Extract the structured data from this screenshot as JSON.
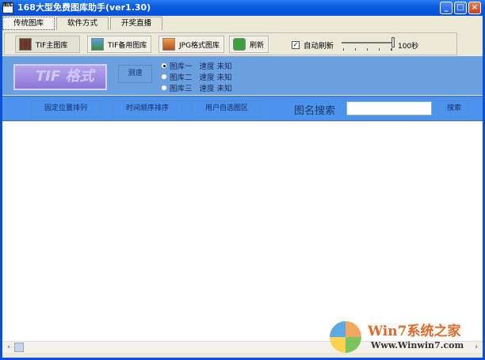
{
  "window": {
    "title": "168大型免费图库助手(ver1.30)",
    "icon_text": "图库",
    "controls": [
      "_",
      "□",
      "×"
    ]
  },
  "tabs": [
    {
      "label": "传统图库",
      "active": true
    },
    {
      "label": "软件方式"
    },
    {
      "label": "开奖直播"
    }
  ],
  "toolbar": {
    "buttons": [
      "TIF主图库",
      "TIF备用图库",
      "JPG格式图库",
      "刷新"
    ],
    "auto_refresh_label": "自动刷新",
    "auto_refresh_checked": true,
    "slider_value_label": "100秒",
    "slider_fraction": 1.0
  },
  "panel": {
    "logo_text": "TIF 格式",
    "speed_test_label": "测速",
    "libraries": [
      {
        "label": "图库一",
        "speed": "速度 未知",
        "selected": true
      },
      {
        "label": "图库二",
        "speed": "速度 未知",
        "selected": false
      },
      {
        "label": "图库三",
        "speed": "速度 未知",
        "selected": false
      }
    ]
  },
  "sortbar": {
    "buttons": [
      "固定位置排列",
      "时间顺序排序",
      "用户自选图区"
    ],
    "search_label": "图名搜索",
    "search_value": "",
    "search_button": "搜索"
  },
  "watermark": {
    "brand": "Win7系统之家",
    "url": "Www.Winwin7.com"
  }
}
